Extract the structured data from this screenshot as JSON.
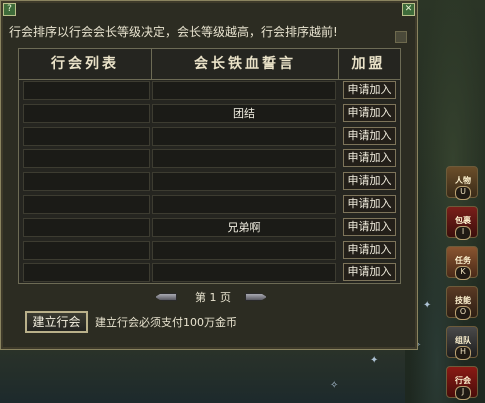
{
  "window": {
    "notice": "行会排序以行会会长等级决定，会长等级越高，行会排序越前!",
    "corner_left_icon": "minimize-icon",
    "corner_right_icon": "close-icon"
  },
  "table": {
    "headers": [
      "行会列表",
      "会长铁血誓言",
      "加盟"
    ],
    "rows": [
      {
        "guild": "",
        "oath": "",
        "join": "申请加入"
      },
      {
        "guild": "",
        "oath": "团结",
        "join": "申请加入"
      },
      {
        "guild": "",
        "oath": "",
        "join": "申请加入"
      },
      {
        "guild": "",
        "oath": "",
        "join": "申请加入"
      },
      {
        "guild": "",
        "oath": "",
        "join": "申请加入"
      },
      {
        "guild": "",
        "oath": "",
        "join": "申请加入"
      },
      {
        "guild": "",
        "oath": "兄弟啊",
        "join": "申请加入"
      },
      {
        "guild": "",
        "oath": "",
        "join": "申请加入"
      },
      {
        "guild": "",
        "oath": "",
        "join": "申请加入"
      }
    ]
  },
  "pager": {
    "label": "第 1 页"
  },
  "build": {
    "button": "建立行会",
    "note": "建立行会必须支付100万金币"
  },
  "side_buttons": [
    {
      "icon": "character-icon",
      "label": "人物",
      "key": "U"
    },
    {
      "icon": "bag-icon",
      "label": "包裹",
      "key": "I"
    },
    {
      "icon": "quest-icon",
      "label": "任务",
      "key": "K"
    },
    {
      "icon": "skill-icon",
      "label": "技能",
      "key": "O"
    },
    {
      "icon": "team-icon",
      "label": "组队",
      "key": "H"
    },
    {
      "icon": "guild-icon",
      "label": "行会",
      "key": "J"
    }
  ],
  "colors": {
    "panel": "#2c2c22",
    "border": "#8a8460",
    "text": "#e8e3cf"
  }
}
